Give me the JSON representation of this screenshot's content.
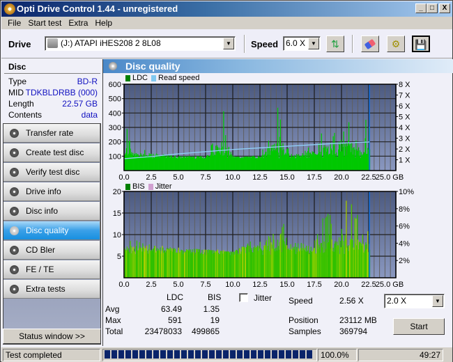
{
  "window": {
    "title": "Opti Drive Control 1.44 - unregistered",
    "buttons": [
      "_",
      "□",
      "X"
    ]
  },
  "menu": [
    "File",
    "Start test",
    "Extra",
    "Help"
  ],
  "toolbar": {
    "drive_label": "Drive",
    "drive_value": "(J:)  ATAPI iHES208   2 8L08",
    "speed_label": "Speed",
    "speed_value": "6.0 X",
    "icons": [
      "refresh-icon",
      "eraser-icon",
      "settings-icon",
      "save-icon"
    ]
  },
  "disc": {
    "header": "Disc",
    "rows": [
      {
        "label": "Type",
        "value": "BD-R"
      },
      {
        "label": "MID",
        "value": "TDKBLDRBB (000)"
      },
      {
        "label": "Length",
        "value": "22.57 GB"
      },
      {
        "label": "Contents",
        "value": "data"
      }
    ]
  },
  "nav": {
    "items": [
      {
        "label": "Transfer rate",
        "selected": false
      },
      {
        "label": "Create test disc",
        "selected": false
      },
      {
        "label": "Verify test disc",
        "selected": false
      },
      {
        "label": "Drive info",
        "selected": false
      },
      {
        "label": "Disc info",
        "selected": false
      },
      {
        "label": "Disc quality",
        "selected": true
      },
      {
        "label": "CD Bler",
        "selected": false
      },
      {
        "label": "FE / TE",
        "selected": false
      },
      {
        "label": "Extra tests",
        "selected": false
      }
    ],
    "status_window": "Status window >>"
  },
  "main": {
    "title": "Disc quality"
  },
  "chart_data": [
    {
      "type": "bar",
      "title": "LDC / Read speed",
      "legend": [
        {
          "name": "LDC",
          "color": "#008000"
        },
        {
          "name": "Read speed",
          "color": "#80c8f0"
        }
      ],
      "x_ticks": [
        "0.0",
        "2.5",
        "5.0",
        "7.5",
        "10.0",
        "12.5",
        "15.0",
        "17.5",
        "20.0",
        "22.5",
        "25.0 GB"
      ],
      "y_left_ticks": [
        "100",
        "200",
        "300",
        "400",
        "500",
        "600"
      ],
      "y_right_ticks": [
        "1 X",
        "2 X",
        "3 X",
        "4 X",
        "5 X",
        "6 X",
        "7 X",
        "8 X"
      ],
      "xlim": [
        0,
        25
      ],
      "ylim": [
        0,
        600
      ],
      "y2lim": [
        0,
        8
      ],
      "end_marker_gb": 22.57,
      "ldc_profile": [
        [
          0,
          175
        ],
        [
          0.3,
          420
        ],
        [
          0.5,
          460
        ],
        [
          0.8,
          250
        ],
        [
          1,
          160
        ],
        [
          2,
          140
        ],
        [
          3,
          120
        ],
        [
          4,
          110
        ],
        [
          5,
          100
        ],
        [
          7.5,
          100
        ],
        [
          9.2,
          490
        ],
        [
          10,
          95
        ],
        [
          12.5,
          100
        ],
        [
          14.6,
          590
        ],
        [
          15,
          160
        ],
        [
          16,
          140
        ],
        [
          17.5,
          180
        ],
        [
          18.5,
          340
        ],
        [
          19.5,
          400
        ],
        [
          20.5,
          480
        ],
        [
          21.5,
          260
        ],
        [
          22.3,
          370
        ],
        [
          22.57,
          300
        ]
      ],
      "ldc_base": 95,
      "read_speed": [
        [
          0,
          1.1
        ],
        [
          2.5,
          1.3
        ],
        [
          5,
          1.55
        ],
        [
          7.5,
          1.75
        ],
        [
          10,
          1.95
        ],
        [
          12.5,
          2.1
        ],
        [
          15,
          2.25
        ],
        [
          17.5,
          2.4
        ],
        [
          20,
          2.55
        ],
        [
          22.57,
          2.65
        ]
      ]
    },
    {
      "type": "bar",
      "title": "BIS / Jitter",
      "legend": [
        {
          "name": "BIS",
          "color": "#008000"
        },
        {
          "name": "Jitter",
          "color": "#d0a0d0"
        }
      ],
      "x_ticks": [
        "0.0",
        "2.5",
        "5.0",
        "7.5",
        "10.0",
        "12.5",
        "15.0",
        "17.5",
        "20.0",
        "22.5",
        "25.0 GB"
      ],
      "y_left_ticks": [
        "5",
        "10",
        "15",
        "20"
      ],
      "y_right_ticks": [
        "2%",
        "4%",
        "6%",
        "8%",
        "10%"
      ],
      "xlim": [
        0,
        25
      ],
      "ylim": [
        0,
        20
      ],
      "y2lim": [
        0,
        10
      ],
      "end_marker_gb": 22.57,
      "bis_profile": [
        [
          0,
          7
        ],
        [
          0.5,
          10
        ],
        [
          1,
          9
        ],
        [
          2,
          8
        ],
        [
          5,
          7
        ],
        [
          10,
          6
        ],
        [
          14.6,
          13
        ],
        [
          15,
          8
        ],
        [
          17.5,
          9
        ],
        [
          18.5,
          17
        ],
        [
          19.5,
          14
        ],
        [
          20.5,
          19
        ],
        [
          22.57,
          10
        ]
      ],
      "bis_base": 6
    }
  ],
  "stats": {
    "col_ldc": "LDC",
    "col_bis": "BIS",
    "rows": [
      {
        "label": "Avg",
        "ldc": "63.49",
        "bis": "1.35"
      },
      {
        "label": "Max",
        "ldc": "591",
        "bis": "19"
      },
      {
        "label": "Total",
        "ldc": "23478033",
        "bis": "499865"
      }
    ],
    "jitter_label": "Jitter",
    "jitter_checked": false,
    "speed_label": "Speed",
    "speed_value": "2.56 X",
    "speed_select": "2.0 X",
    "position_label": "Position",
    "position_value": "23112 MB",
    "samples_label": "Samples",
    "samples_value": "369794",
    "start_label": "Start"
  },
  "statusbar": {
    "text": "Test completed",
    "progress_percent": 100.0,
    "progress_label": "100.0%",
    "time": "49:27"
  }
}
